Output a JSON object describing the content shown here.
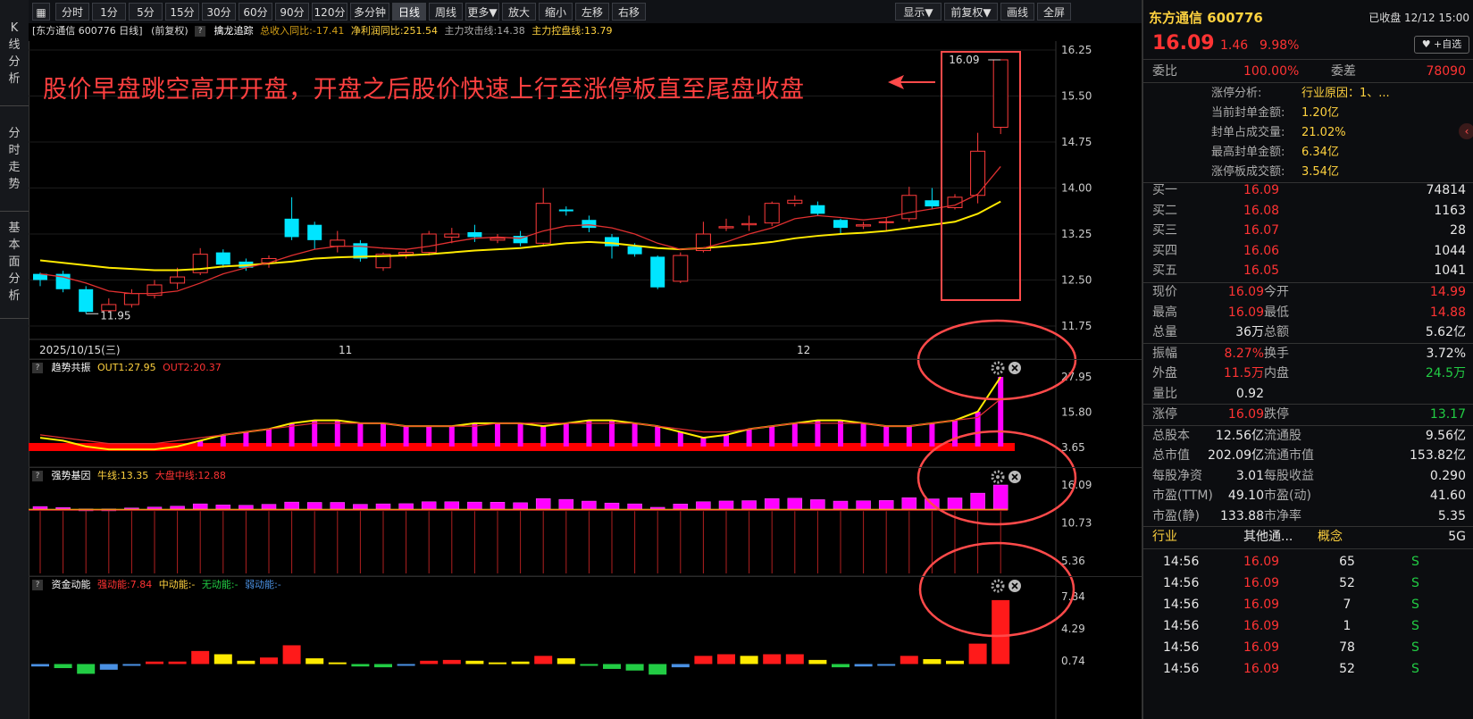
{
  "sidebar": {
    "tabs": [
      "K线分析",
      "分时走势",
      "基本面分析"
    ]
  },
  "toolbar": {
    "left": [
      "分时",
      "1分",
      "5分",
      "15分",
      "30分",
      "60分",
      "90分",
      "120分",
      "多分钟",
      "日线",
      "周线",
      "更多▼",
      "放大",
      "缩小",
      "左移",
      "右移"
    ],
    "active": "日线",
    "right": [
      "显示▼",
      "前复权▼",
      "画线",
      "全屏"
    ]
  },
  "info": {
    "stock": "[东方通信 600776 日线]",
    "adj": "(前复权)",
    "indicator": "擒龙追踪",
    "v1": "总收入同比:-17.41",
    "v2": "净利润同比:251.54",
    "v3": "主力攻击线:14.38",
    "v4": "主力控盘线:13.79"
  },
  "annotation": {
    "text": "股价早盘跳空高开开盘，开盘之后股价快速上行至涨停板直至尾盘收盘"
  },
  "main_chart": {
    "yticks": [
      "16.25",
      "15.50",
      "14.75",
      "14.00",
      "13.25",
      "12.50",
      "11.75"
    ],
    "low_label": "11.95",
    "high_label": "16.09",
    "xlabels": [
      "2025/10/15(三)",
      "11",
      "12"
    ]
  },
  "chart_data": {
    "type": "candlestick",
    "ylim": [
      11.75,
      16.25
    ],
    "candles": [
      {
        "o": 12.6,
        "c": 12.5,
        "h": 12.62,
        "l": 12.4
      },
      {
        "o": 12.6,
        "c": 12.35,
        "h": 12.65,
        "l": 12.3
      },
      {
        "o": 12.35,
        "c": 11.98,
        "h": 12.4,
        "l": 11.95
      },
      {
        "o": 12.0,
        "c": 12.1,
        "h": 12.2,
        "l": 11.98
      },
      {
        "o": 12.1,
        "c": 12.28,
        "h": 12.35,
        "l": 12.05
      },
      {
        "o": 12.25,
        "c": 12.42,
        "h": 12.5,
        "l": 12.2
      },
      {
        "o": 12.45,
        "c": 12.55,
        "h": 12.7,
        "l": 12.35
      },
      {
        "o": 12.62,
        "c": 12.92,
        "h": 13.02,
        "l": 12.58
      },
      {
        "o": 12.95,
        "c": 12.75,
        "h": 13.0,
        "l": 12.7
      },
      {
        "o": 12.8,
        "c": 12.7,
        "h": 12.85,
        "l": 12.65
      },
      {
        "o": 12.78,
        "c": 12.85,
        "h": 12.9,
        "l": 12.7
      },
      {
        "o": 13.5,
        "c": 13.2,
        "h": 13.85,
        "l": 13.15
      },
      {
        "o": 13.4,
        "c": 13.15,
        "h": 13.45,
        "l": 13.0
      },
      {
        "o": 13.05,
        "c": 13.15,
        "h": 13.3,
        "l": 12.95
      },
      {
        "o": 13.1,
        "c": 12.85,
        "h": 13.15,
        "l": 12.8
      },
      {
        "o": 12.7,
        "c": 12.92,
        "h": 12.95,
        "l": 12.65
      },
      {
        "o": 12.92,
        "c": 12.95,
        "h": 13.0,
        "l": 12.85
      },
      {
        "o": 12.95,
        "c": 13.25,
        "h": 13.3,
        "l": 12.9
      },
      {
        "o": 13.2,
        "c": 13.25,
        "h": 13.35,
        "l": 13.1
      },
      {
        "o": 13.28,
        "c": 13.2,
        "h": 13.4,
        "l": 13.12
      },
      {
        "o": 13.15,
        "c": 13.18,
        "h": 13.25,
        "l": 13.1
      },
      {
        "o": 13.22,
        "c": 13.1,
        "h": 13.3,
        "l": 13.05
      },
      {
        "o": 13.1,
        "c": 13.75,
        "h": 14.0,
        "l": 13.05
      },
      {
        "o": 13.65,
        "c": 13.62,
        "h": 13.7,
        "l": 13.55
      },
      {
        "o": 13.48,
        "c": 13.35,
        "h": 13.55,
        "l": 13.28
      },
      {
        "o": 13.2,
        "c": 13.05,
        "h": 13.25,
        "l": 12.85
      },
      {
        "o": 13.05,
        "c": 12.92,
        "h": 13.1,
        "l": 12.88
      },
      {
        "o": 12.88,
        "c": 12.38,
        "h": 12.9,
        "l": 12.35
      },
      {
        "o": 12.48,
        "c": 12.9,
        "h": 12.95,
        "l": 12.45
      },
      {
        "o": 12.98,
        "c": 13.25,
        "h": 13.45,
        "l": 12.95
      },
      {
        "o": 13.35,
        "c": 13.37,
        "h": 13.5,
        "l": 13.3
      },
      {
        "o": 13.4,
        "c": 13.42,
        "h": 13.55,
        "l": 13.3
      },
      {
        "o": 13.43,
        "c": 13.75,
        "h": 13.78,
        "l": 13.38
      },
      {
        "o": 13.75,
        "c": 13.8,
        "h": 13.88,
        "l": 13.7
      },
      {
        "o": 13.72,
        "c": 13.58,
        "h": 13.78,
        "l": 13.55
      },
      {
        "o": 13.48,
        "c": 13.35,
        "h": 13.5,
        "l": 13.25
      },
      {
        "o": 13.38,
        "c": 13.4,
        "h": 13.45,
        "l": 13.33
      },
      {
        "o": 13.45,
        "c": 13.45,
        "h": 13.52,
        "l": 13.3
      },
      {
        "o": 13.5,
        "c": 13.88,
        "h": 14.02,
        "l": 13.45
      },
      {
        "o": 13.8,
        "c": 13.7,
        "h": 14.0,
        "l": 13.65
      },
      {
        "o": 13.68,
        "c": 13.85,
        "h": 13.9,
        "l": 13.65
      },
      {
        "o": 13.88,
        "c": 14.6,
        "h": 14.9,
        "l": 13.75
      },
      {
        "o": 14.99,
        "c": 16.09,
        "h": 16.09,
        "l": 14.88
      }
    ],
    "ma_yellow": [
      12.82,
      12.78,
      12.74,
      12.7,
      12.68,
      12.66,
      12.66,
      12.68,
      12.72,
      12.74,
      12.77,
      12.8,
      12.85,
      12.87,
      12.88,
      12.89,
      12.9,
      12.92,
      12.95,
      12.98,
      13.0,
      13.02,
      13.06,
      13.1,
      13.12,
      13.1,
      13.06,
      13.02,
      13.0,
      13.02,
      13.05,
      13.08,
      13.12,
      13.18,
      13.22,
      13.25,
      13.27,
      13.3,
      13.35,
      13.4,
      13.45,
      13.58,
      13.78
    ],
    "ma_red": [
      12.6,
      12.55,
      12.45,
      12.32,
      12.28,
      12.28,
      12.32,
      12.45,
      12.6,
      12.7,
      12.78,
      12.9,
      13.0,
      13.05,
      13.05,
      13.02,
      13.0,
      13.05,
      13.12,
      13.18,
      13.2,
      13.18,
      13.3,
      13.38,
      13.4,
      13.35,
      13.25,
      13.1,
      13.0,
      13.02,
      13.12,
      13.25,
      13.35,
      13.5,
      13.55,
      13.52,
      13.48,
      13.52,
      13.6,
      13.66,
      13.72,
      13.9,
      14.35
    ]
  },
  "panel1": {
    "name": "趋势共振",
    "out1": "OUT1:27.95",
    "out2": "OUT2:20.37",
    "yticks": [
      "27.95",
      "15.80",
      "3.65"
    ]
  },
  "panel2": {
    "name": "强势基因",
    "l1": "牛线:13.35",
    "l2": "大盘中线:12.88",
    "yticks": [
      "16.09",
      "10.73",
      "5.36"
    ]
  },
  "panel3": {
    "name": "资金动能",
    "l1": "强动能:7.84",
    "l2": "中动能:-",
    "l3": "无动能:-",
    "l4": "弱动能:-",
    "yticks": [
      "7.84",
      "4.29",
      "0.74"
    ]
  },
  "quote": {
    "name": "东方通信 600776",
    "status": "已收盘 12/12 15:00",
    "price": "16.09",
    "change": "1.46",
    "pct": "9.98%",
    "fav": "♥ +自选",
    "weibi_label": "委比",
    "weibi": "100.00%",
    "weicha_label": "委差",
    "weicha": "78090",
    "limit": [
      {
        "k": "涨停分析:",
        "v": "行业原因：1、..."
      },
      {
        "k": "当前封单金额:",
        "v": "1.20亿"
      },
      {
        "k": "封单占成交量:",
        "v": "21.02%"
      },
      {
        "k": "最高封单金额:",
        "v": "6.34亿"
      },
      {
        "k": "涨停板成交额:",
        "v": "3.54亿"
      }
    ],
    "buy": [
      {
        "k": "买一",
        "p": "16.09",
        "v": "74814"
      },
      {
        "k": "买二",
        "p": "16.08",
        "v": "1163"
      },
      {
        "k": "买三",
        "p": "16.07",
        "v": "28"
      },
      {
        "k": "买四",
        "p": "16.06",
        "v": "1044"
      },
      {
        "k": "买五",
        "p": "16.05",
        "v": "1041"
      }
    ],
    "stats1": [
      {
        "k1": "现价",
        "v1": "16.09",
        "c1": "red",
        "k2": "今开",
        "v2": "14.99",
        "c2": "red"
      },
      {
        "k1": "最高",
        "v1": "16.09",
        "c1": "red",
        "k2": "最低",
        "v2": "14.88",
        "c2": "red"
      },
      {
        "k1": "总量",
        "v1": "36万",
        "c1": "white",
        "k2": "总额",
        "v2": "5.62亿",
        "c2": "white"
      }
    ],
    "stats2": [
      {
        "k1": "振幅",
        "v1": "8.27%",
        "c1": "red",
        "k2": "换手",
        "v2": "3.72%",
        "c2": "white"
      },
      {
        "k1": "外盘",
        "v1": "11.5万",
        "c1": "red",
        "k2": "内盘",
        "v2": "24.5万",
        "c2": "green"
      },
      {
        "k1": "量比",
        "v1": "0.92",
        "c1": "white",
        "k2": "",
        "v2": "",
        "c2": "white"
      }
    ],
    "stats3": [
      {
        "k1": "涨停",
        "v1": "16.09",
        "c1": "red",
        "k2": "跌停",
        "v2": "13.17",
        "c2": "green"
      }
    ],
    "stats4": [
      {
        "k1": "总股本",
        "v1": "12.56亿",
        "c1": "white",
        "k2": "流通股",
        "v2": "9.56亿",
        "c2": "white"
      },
      {
        "k1": "总市值",
        "v1": "202.09亿",
        "c1": "white",
        "k2": "流通市值",
        "v2": "153.82亿",
        "c2": "white"
      },
      {
        "k1": "每股净资",
        "v1": "3.01",
        "c1": "white",
        "k2": "每股收益",
        "v2": "0.290",
        "c2": "white"
      },
      {
        "k1": "市盈(TTM)",
        "v1": "49.10",
        "c1": "white",
        "k2": "市盈(动)",
        "v2": "41.60",
        "c2": "white"
      },
      {
        "k1": "市盈(静)",
        "v1": "133.88",
        "c1": "white",
        "k2": "市净率",
        "v2": "5.35",
        "c2": "white"
      }
    ],
    "industry": {
      "k1": "行业",
      "v1": "其他通...",
      "k2": "概念",
      "v2": "5G"
    },
    "ticks": [
      {
        "t": "14:56",
        "p": "16.09",
        "v": "65",
        "s": "S"
      },
      {
        "t": "14:56",
        "p": "16.09",
        "v": "52",
        "s": "S"
      },
      {
        "t": "14:56",
        "p": "16.09",
        "v": "7",
        "s": "S"
      },
      {
        "t": "14:56",
        "p": "16.09",
        "v": "1",
        "s": "S"
      },
      {
        "t": "14:56",
        "p": "16.09",
        "v": "78",
        "s": "S"
      },
      {
        "t": "14:56",
        "p": "16.09",
        "v": "52",
        "s": "S"
      }
    ]
  }
}
